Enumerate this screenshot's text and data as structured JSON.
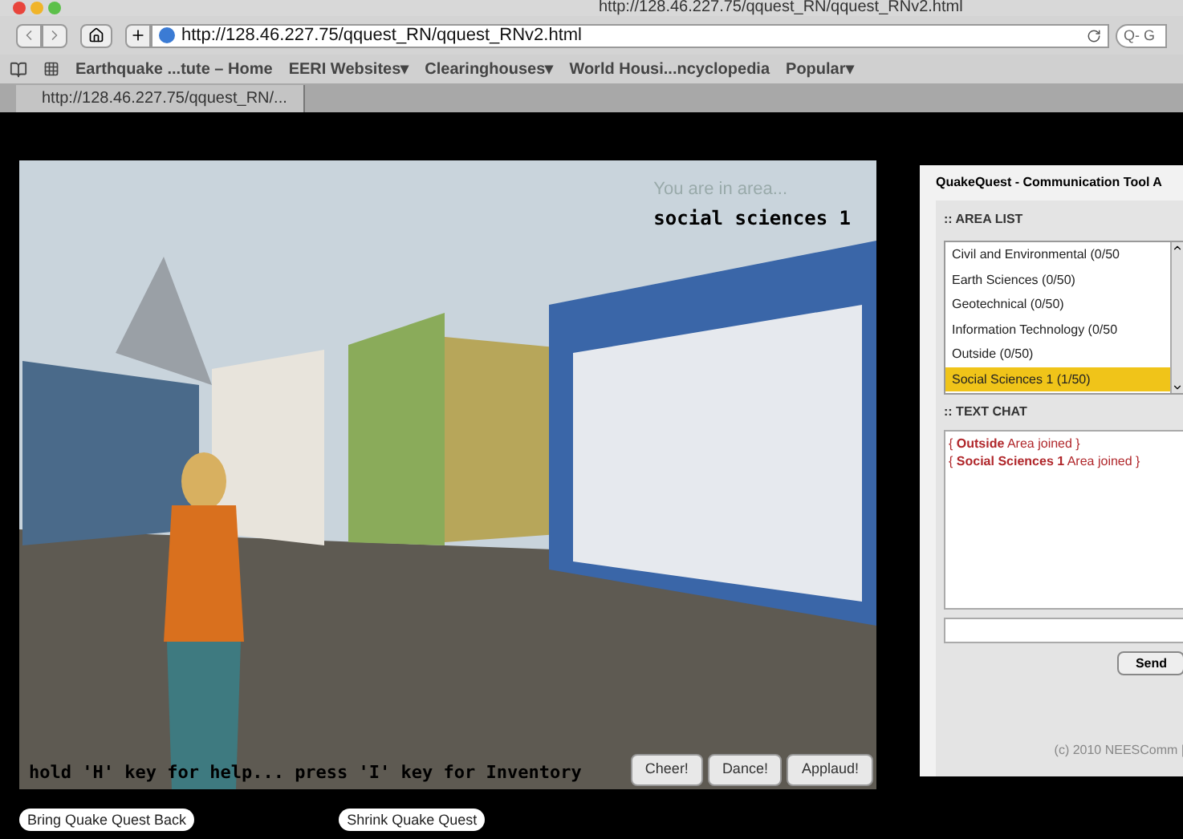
{
  "window": {
    "title": "http://128.46.227.75/qquest_RN/qquest_RNv2.html"
  },
  "toolbar": {
    "address": "http://128.46.227.75/qquest_RN/qquest_RNv2.html",
    "search_placeholder": "Q‑ G"
  },
  "bookmarks": [
    "Earthquake ...tute – Home",
    "EERI Websites▾",
    "Clearinghouses▾",
    "World Housi...ncyclopedia",
    "Popular▾"
  ],
  "tabs": [
    {
      "label": "http://128.46.227.75/qquest_RN/...",
      "selected": true
    }
  ],
  "scene": {
    "area_caption": "You are in area...",
    "area_name": "social sciences 1",
    "help": "hold 'H' key for help... press 'I' key for Inventory",
    "actions": [
      "Cheer!",
      "Dance!",
      "Applaud!"
    ]
  },
  "panel": {
    "title": "QuakeQuest - Communication Tool A",
    "area_heading": ":: AREA LIST",
    "areas": [
      {
        "label": "Civil and Environmental (0/50",
        "selected": false
      },
      {
        "label": "Earth Sciences (0/50)",
        "selected": false
      },
      {
        "label": "Geotechnical (0/50)",
        "selected": false
      },
      {
        "label": "Information Technology (0/50",
        "selected": false
      },
      {
        "label": "Outside (0/50)",
        "selected": false
      },
      {
        "label": "Social Sciences 1 (1/50)",
        "selected": true
      }
    ],
    "chat_heading": ":: TEXT CHAT",
    "chat": [
      "{ **Outside** Area joined }",
      "{ **Social Sciences 1** Area joined }"
    ],
    "send": "Send",
    "footer": "(c) 2010 NEESComm |"
  },
  "bottom_buttons": [
    "Bring Quake Quest Back",
    "Shrink Quake Quest"
  ]
}
